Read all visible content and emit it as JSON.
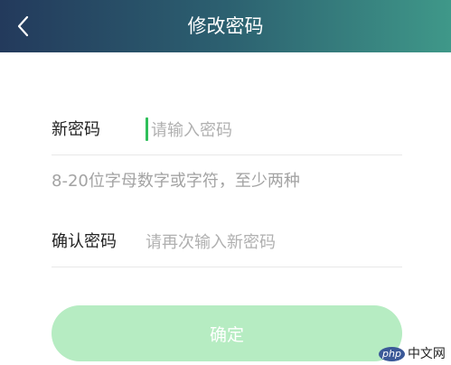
{
  "header": {
    "title": "修改密码",
    "back_icon": "chevron-left-icon"
  },
  "form": {
    "new_password": {
      "label": "新密码",
      "placeholder": "请输入密码"
    },
    "hint": "8-20位字母数字或字符，至少两种",
    "confirm_password": {
      "label": "确认密码",
      "placeholder": "请再次输入新密码"
    }
  },
  "confirm_button": {
    "label": "确定"
  },
  "watermark": {
    "brand": "php",
    "text": "中文网"
  },
  "colors": {
    "header_start": "#233a5c",
    "header_end": "#3f9889",
    "button_bg": "#b6ecc2",
    "caret": "#2fbf5a"
  }
}
